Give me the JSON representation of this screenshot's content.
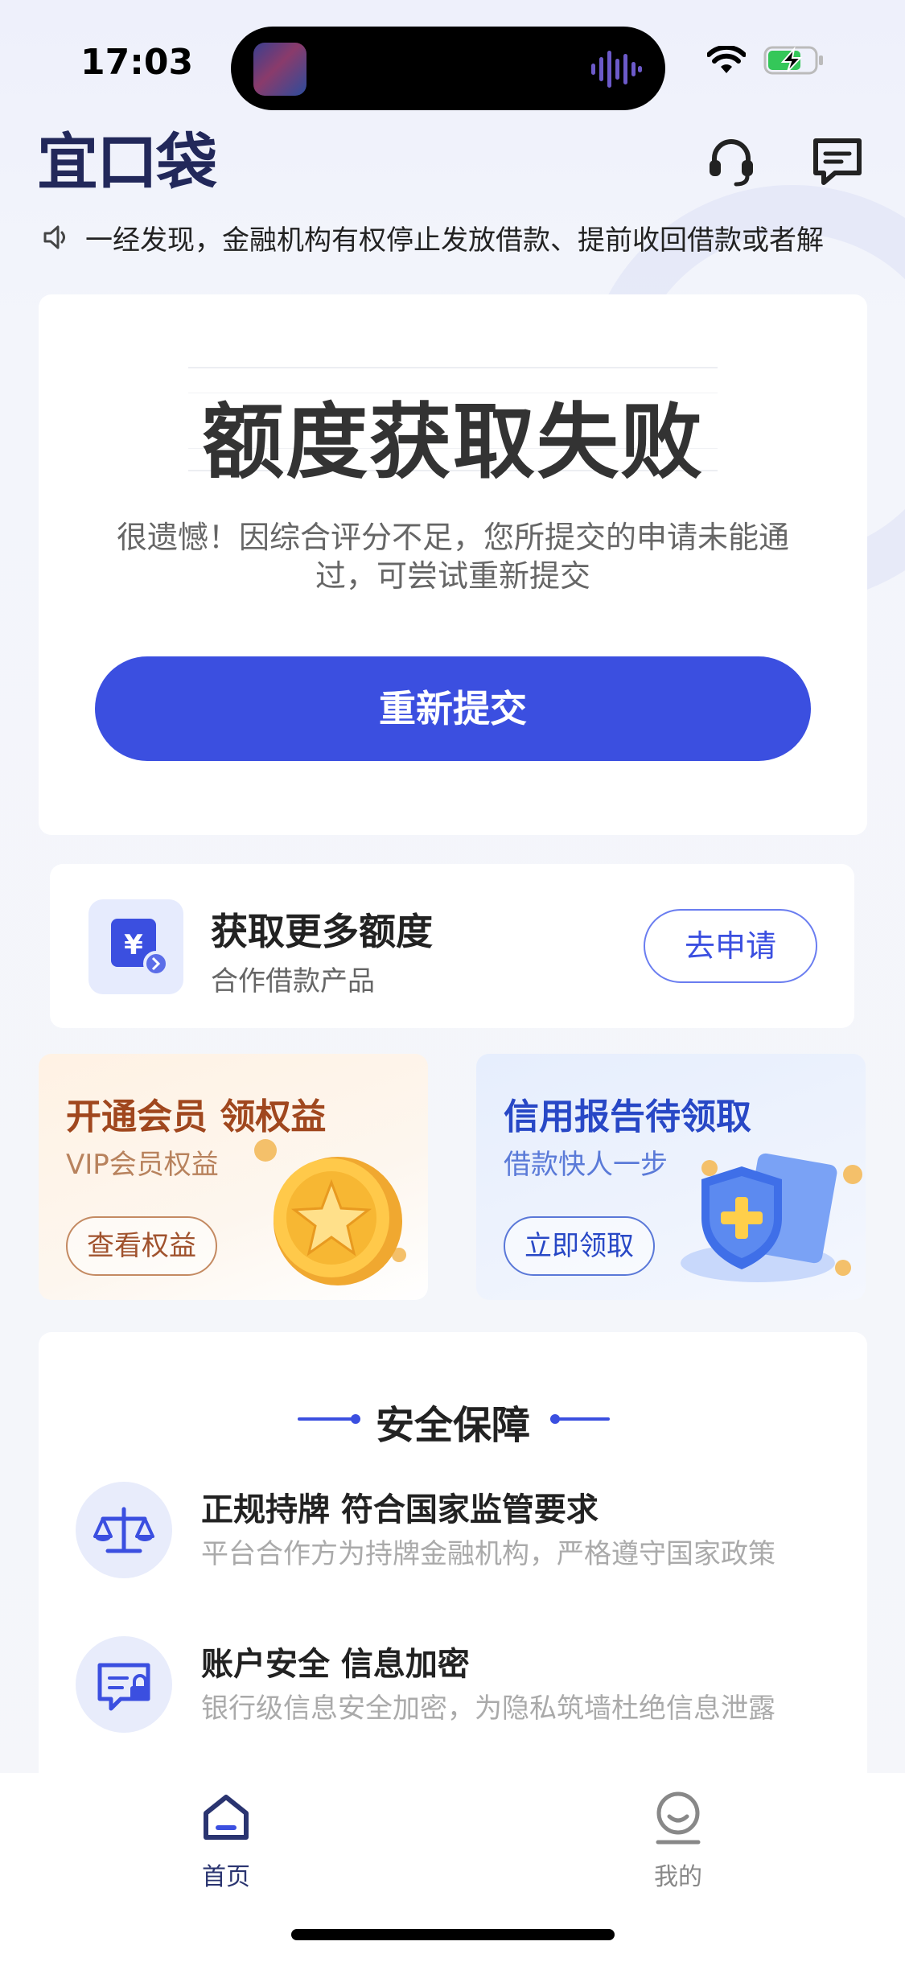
{
  "status_bar": {
    "time": "17:03"
  },
  "header": {
    "logo_text": "宜口袋"
  },
  "notice": {
    "text": "一经发现，金融机构有权停止发放借款、提前收回借款或者解"
  },
  "result": {
    "title": "额度获取失败",
    "description": "很遗憾！因综合评分不足，您所提交的申请未能通过，可尝试重新提交",
    "retry_label": "重新提交"
  },
  "more_quota": {
    "title": "获取更多额度",
    "subtitle": "合作借款产品",
    "button_label": "去申请"
  },
  "promos": [
    {
      "title": "开通会员 领权益",
      "subtitle": "VIP会员权益",
      "button_label": "查看权益"
    },
    {
      "title": "信用报告待领取",
      "subtitle": "借款快人一步",
      "button_label": "立即领取"
    }
  ],
  "security": {
    "heading": "安全保障",
    "items": [
      {
        "title": "正规持牌 符合国家监管要求",
        "desc": "平台合作方为持牌金融机构，严格遵守国家政策",
        "icon": "scale-icon"
      },
      {
        "title": "账户安全 信息加密",
        "desc": "银行级信息安全加密，为隐私筑墙杜绝信息泄露",
        "icon": "secure-message-icon"
      }
    ]
  },
  "tabbar": {
    "tabs": [
      {
        "label": "首页",
        "icon": "home-icon",
        "active": true
      },
      {
        "label": "我的",
        "icon": "profile-icon",
        "active": false
      }
    ]
  },
  "colors": {
    "accent": "#3b4fe0",
    "brand_dark": "#22285a"
  }
}
